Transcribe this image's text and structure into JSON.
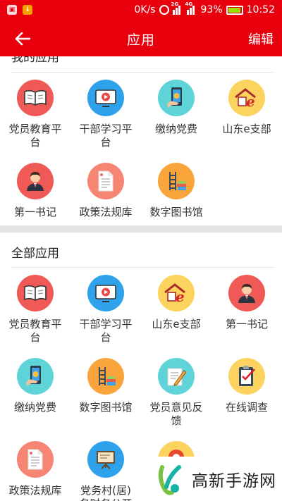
{
  "status_bar": {
    "speed": "0K/s",
    "net_2g": "2G",
    "net_4g": "4G",
    "battery": "93%",
    "time": "10:52"
  },
  "app_bar": {
    "title": "应用",
    "edit_label": "编辑"
  },
  "my_apps": {
    "heading": "我的应用",
    "items": [
      {
        "label": "党员教育平台",
        "icon": "book-icon",
        "color": "#f05a56"
      },
      {
        "label": "干部学习平台",
        "icon": "video-play-icon",
        "color": "#2ea3ec"
      },
      {
        "label": "缴纳党费",
        "icon": "mobile-payment-icon",
        "color": "#5fd4d8"
      },
      {
        "label": "山东e支部",
        "icon": "house-e-icon",
        "color": "#fbd35e"
      },
      {
        "label": "第一书记",
        "icon": "person-icon",
        "color": "#f05a56"
      },
      {
        "label": "政策法规库",
        "icon": "document-icon",
        "color": "#f78573"
      },
      {
        "label": "数字图书馆",
        "icon": "library-icon",
        "color": "#f9a53c"
      }
    ]
  },
  "all_apps": {
    "heading": "全部应用",
    "items": [
      {
        "label": "党员教育平台",
        "icon": "book-icon",
        "color": "#f05a56"
      },
      {
        "label": "干部学习平台",
        "icon": "video-play-icon",
        "color": "#2ea3ec"
      },
      {
        "label": "山东e支部",
        "icon": "house-e-icon",
        "color": "#fbd35e"
      },
      {
        "label": "第一书记",
        "icon": "person-icon",
        "color": "#f05a56"
      },
      {
        "label": "缴纳党费",
        "icon": "mobile-payment-icon",
        "color": "#5fd4d8"
      },
      {
        "label": "数字图书馆",
        "icon": "library-icon",
        "color": "#f9a53c"
      },
      {
        "label": "党员意见反馈",
        "icon": "pencil-paper-icon",
        "color": "#5fd4d8"
      },
      {
        "label": "在线调查",
        "icon": "clipboard-check-icon",
        "color": "#fbd35e"
      },
      {
        "label": "政策法规库",
        "icon": "document-icon",
        "color": "#f78573"
      },
      {
        "label": "党务村(居)务财务公开",
        "icon": "presentation-board-icon",
        "color": "#2ea3ec"
      },
      {
        "label": "",
        "icon": "location-pin-icon",
        "color": "#fbd35e"
      }
    ]
  },
  "watermark": {
    "text": "高新手游网"
  }
}
